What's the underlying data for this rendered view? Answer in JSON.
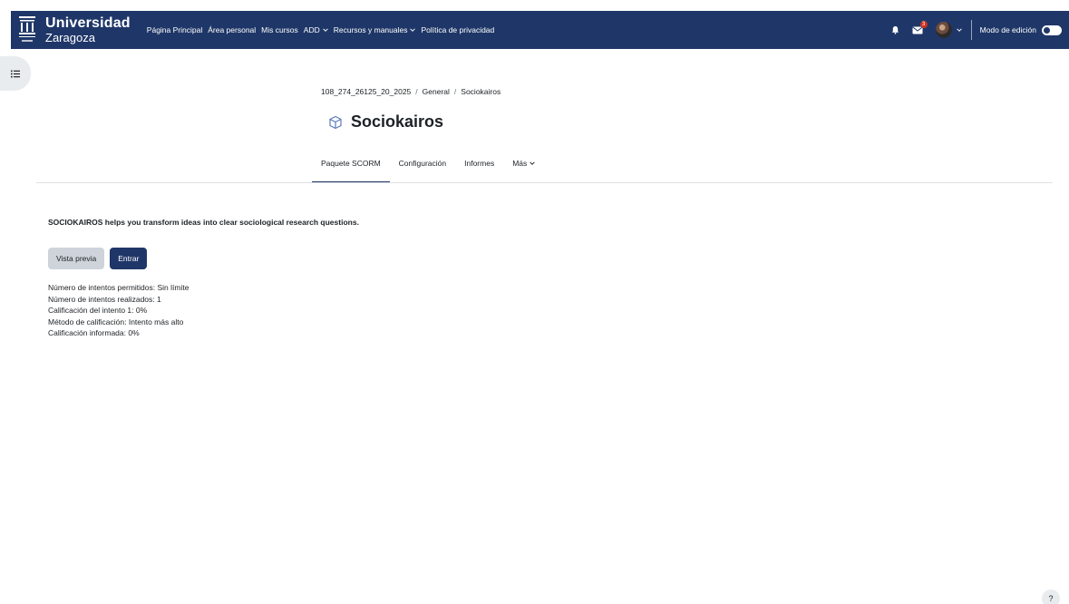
{
  "header": {
    "logo": {
      "line1": "Universidad",
      "line2": "Zaragoza"
    },
    "nav": [
      {
        "label": "Página Principal",
        "dropdown": false
      },
      {
        "label": "Área personal",
        "dropdown": false
      },
      {
        "label": "Mis cursos",
        "dropdown": false
      },
      {
        "label": "ADD",
        "dropdown": true
      },
      {
        "label": "Recursos y manuales",
        "dropdown": true
      },
      {
        "label": "Política de privacidad",
        "dropdown": false
      }
    ],
    "messages_badge": "3",
    "edit_mode_label": "Modo de edición",
    "icons": {
      "notifications": "bell-icon",
      "messages": "envelope-icon",
      "avatar": "user-avatar",
      "edit_toggle": "toggle-switch"
    }
  },
  "breadcrumb": [
    "108_274_26125_20_2025",
    "General",
    "Sociokairos"
  ],
  "page_title": "Sociokairos",
  "page_icon": "scorm-package-icon",
  "tabs": [
    "Paquete SCORM",
    "Configuración",
    "Informes",
    "Más"
  ],
  "active_tab": 0,
  "intro_text": "SOCIOKAIROS helps you transform ideas into clear sociological research questions.",
  "buttons": {
    "preview": "Vista previa",
    "enter": "Entrar"
  },
  "info": [
    "Número de intentos permitidos: Sin límite",
    "Número de intentos realizados: 1",
    "Calificación del intento 1: 0%",
    "Método de calificación: Intento más alto",
    "Calificación informada: 0%"
  ],
  "help_label": "?",
  "colors": {
    "navbar": "#1f3768",
    "primary": "#1f3768",
    "secondary": "#ced4da",
    "badge": "#ca3120"
  }
}
